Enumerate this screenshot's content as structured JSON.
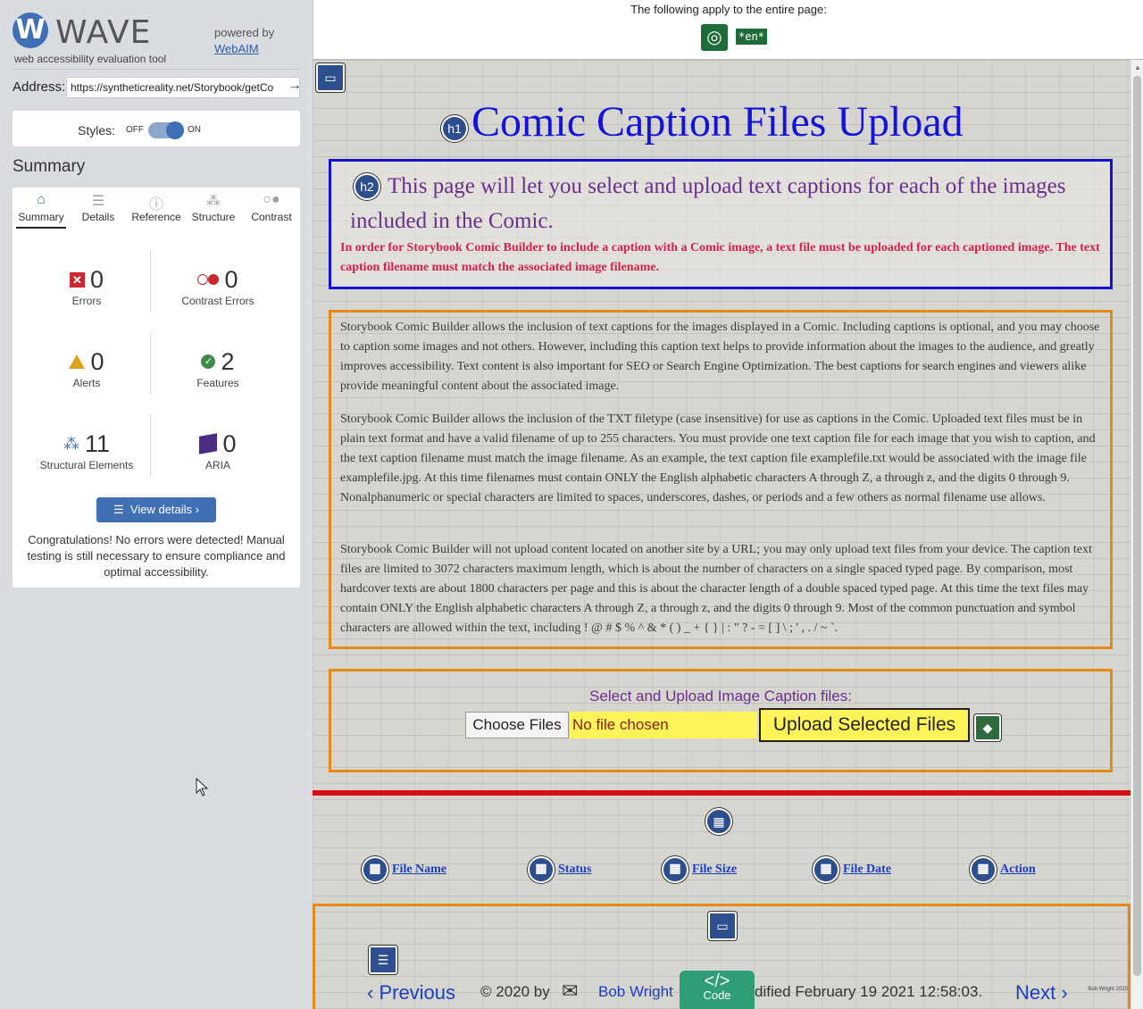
{
  "wave": {
    "logo_letter": "W",
    "logo_name": "WAVE",
    "tagline": "web accessibility evaluation tool",
    "powered_by": "powered by",
    "webaim": "WebAIM",
    "address_label": "Address:",
    "address_value": "https://syntheticreality.net/Storybook/getCo",
    "styles_label": "Styles:",
    "styles_off": "OFF",
    "styles_on": "ON",
    "summary_title": "Summary",
    "tabs": [
      {
        "label": "Summary",
        "icon": "home-icon"
      },
      {
        "label": "Details",
        "icon": "list-icon"
      },
      {
        "label": "Reference",
        "icon": "info-icon"
      },
      {
        "label": "Structure",
        "icon": "structure-icon"
      },
      {
        "label": "Contrast",
        "icon": "contrast-icon"
      }
    ],
    "stats": {
      "errors": {
        "count": "0",
        "label": "Errors"
      },
      "contrast": {
        "count": "0",
        "label": "Contrast Errors"
      },
      "alerts": {
        "count": "0",
        "label": "Alerts"
      },
      "features": {
        "count": "2",
        "label": "Features"
      },
      "structural": {
        "count": "11",
        "label": "Structural Elements"
      },
      "aria": {
        "count": "0",
        "label": "ARIA"
      }
    },
    "view_details": "View details ›",
    "congrats": "Congratulations! No errors were detected! Manual testing is still necessary to ensure compliance and optimal accessibility."
  },
  "topbar": {
    "text": "The following apply to the entire page:",
    "lang": "*en*"
  },
  "page": {
    "h1": "Comic Caption Files Upload",
    "h2": "This page will let you select and upload text captions for each of the images included in the Comic.",
    "red_note": "In order for Storybook Comic Builder to include a caption with a Comic image, a text file must be uploaded for each captioned image. The text caption filename must match the associated image filename.",
    "para1": "Storybook Comic Builder allows the inclusion of text captions for the images displayed in a Comic. Including captions is optional, and you may choose to caption some images and not others. However, including this caption text helps to provide information about the images to the audience, and greatly improves accessibility. Text content is also important for SEO or Search Engine Optimization. The best captions for search engines and viewers alike provide meaningful content about the associated image.",
    "para2": "Storybook Comic Builder allows the inclusion of the TXT filetype (case insensitive) for use as captions in the Comic. Uploaded text files must be in plain text format and have a valid filename of up to 255 characters. You must provide one text caption file for each image that you wish to caption, and the text caption filename must match the image filename. As an example, the text caption file examplefile.txt would be associated with the image file examplefile.jpg. At this time filenames must contain ONLY the English alphabetic characters A through Z, a through z, and the digits 0 through 9. Nonalphanumeric or special characters are limited to spaces, underscores, dashes, or periods and a few others as normal filename use allows.",
    "para3": "Storybook Comic Builder will not upload content located on another site by a URL; you may only upload text files from your device. The caption text files are limited to 3072 characters maximum length, which is about the number of characters on a single spaced typed page. By comparison, most hardcover texts are about 1800 characters per page and this is about the character length of a double spaced typed page. At this time the text files may contain ONLY the English alphabetic characters A through Z, a through z, and the digits 0 through 9. Most of the common punctuation and symbol characters are allowed within the text, including ! @ # $ % ^ & * ( ) _ + { } | : \" ? - = [ ] \\ ; ' , . / ~ `.",
    "upload_title": "Select and Upload Image Caption files:",
    "choose_files": "Choose Files",
    "no_file": "No file chosen",
    "upload_button": "Upload Selected Files",
    "columns": [
      "File Name",
      "Status",
      "File Size",
      "File Date",
      "Action"
    ],
    "footer": {
      "previous": "‹ Previous",
      "copyright": "© 2020 by",
      "author": "Bob Wright",
      "modified": "dified February 19 2021 12:58:03.",
      "next": "Next ›",
      "code_label": "Code",
      "tiny_credit": "Bob Wright 2020"
    }
  }
}
